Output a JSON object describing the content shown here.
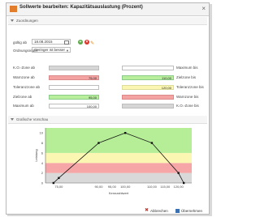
{
  "dialog": {
    "title": "Sollwerte bearbeiten: Kapazitätsauslastung (Prozent)",
    "close_glyph": "×"
  },
  "sections": {
    "zuordnungen": "Zuordnungen",
    "vorschau": "Grafische Vorschau"
  },
  "form": {
    "gueltig_ab_label": "gültig ab",
    "gueltig_ab_value": "18.08.2015",
    "ordnungsregel_label": "Ordnungsregel",
    "ordnungsregel_value": "Geringer ist besser"
  },
  "thresholds": {
    "left": [
      {
        "label": "K.O.-Zone ab",
        "value": "",
        "color": "gray"
      },
      {
        "label": "Warnzone ab",
        "value": "75,00",
        "color": "red"
      },
      {
        "label": "Toleranzzone ab",
        "value": "",
        "color": "white"
      },
      {
        "label": "Zielzone ab",
        "value": "95,00",
        "color": "green"
      },
      {
        "label": "Maximum ab",
        "value": "100,00",
        "color": "white"
      }
    ],
    "right": [
      {
        "label": "Maximum bis",
        "value": "",
        "color": "white"
      },
      {
        "label": "Zielzone bis",
        "value": "110,00",
        "color": "green"
      },
      {
        "label": "Toleranzzone bis",
        "value": "120,00",
        "color": "yellow"
      },
      {
        "label": "Warnzone bis",
        "value": "",
        "color": "red"
      },
      {
        "label": "K.O.-Zone bis",
        "value": "",
        "color": "gray"
      }
    ]
  },
  "chart_data": {
    "type": "line",
    "xlabel": "Kennzahlwert",
    "ylabel": "Leistung",
    "x_ticks": [
      "75,00",
      "90,00",
      "95,00",
      "100,00",
      "110,00",
      "115,00",
      "120,00"
    ],
    "y_ticks": [
      "0",
      "2",
      "4",
      "6",
      "8",
      "10"
    ],
    "xlim": [
      70,
      125
    ],
    "ylim": [
      0,
      11
    ],
    "bands": [
      {
        "from": 0,
        "to": 2,
        "color": "#d9d9d9"
      },
      {
        "from": 2,
        "to": 4,
        "color": "#f6a6a6"
      },
      {
        "from": 4,
        "to": 6,
        "color": "#fbf7b2"
      },
      {
        "from": 6,
        "to": 11,
        "color": "#b6ee98"
      }
    ],
    "x": [
      73,
      75,
      90,
      100,
      110,
      120,
      122
    ],
    "y": [
      0,
      1,
      8,
      10,
      8,
      2,
      0
    ]
  },
  "footer": {
    "abbrechen": "Abbrechen",
    "uebernehmen": "Übernehmen"
  },
  "colors": {
    "accent": "#e27d2b",
    "add": "#5aa845",
    "delete": "#d9342b"
  },
  "icons": {
    "add": "plus-icon",
    "delete": "delete-icon",
    "edit": "pencil-icon"
  }
}
